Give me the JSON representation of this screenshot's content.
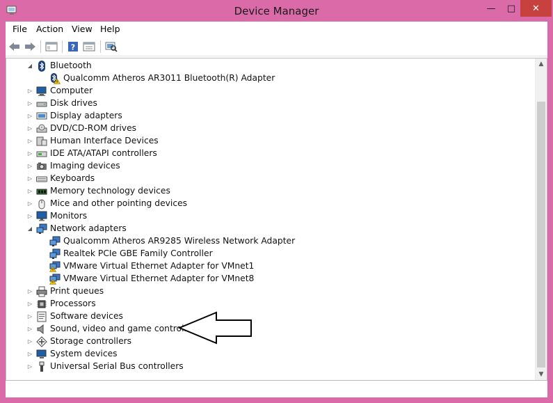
{
  "window": {
    "title": "Device Manager",
    "min_label": "—",
    "max_label": "□",
    "close_label": "✕"
  },
  "menubar": {
    "file": "File",
    "action": "Action",
    "view": "View",
    "help": "Help"
  },
  "toolbar": {
    "icons": [
      "back-arrow-icon",
      "forward-arrow-icon",
      "properties-icon",
      "help-icon",
      "console-tree-icon",
      "scan-hardware-icon"
    ]
  },
  "tree": {
    "items": [
      {
        "label": "Bluetooth",
        "level": 0,
        "expanded": true,
        "icon": "bluetooth-icon"
      },
      {
        "label": "Qualcomm Atheros AR3011 Bluetooth(R) Adapter",
        "level": 1,
        "icon": "bluetooth-warning-icon"
      },
      {
        "label": "Computer",
        "level": 0,
        "expanded": false,
        "icon": "computer-icon"
      },
      {
        "label": "Disk drives",
        "level": 0,
        "expanded": false,
        "icon": "disk-drive-icon"
      },
      {
        "label": "Display adapters",
        "level": 0,
        "expanded": false,
        "icon": "display-adapter-icon"
      },
      {
        "label": "DVD/CD-ROM drives",
        "level": 0,
        "expanded": false,
        "icon": "dvd-drive-icon"
      },
      {
        "label": "Human Interface Devices",
        "level": 0,
        "expanded": false,
        "icon": "hid-icon"
      },
      {
        "label": "IDE ATA/ATAPI controllers",
        "level": 0,
        "expanded": false,
        "icon": "ide-controller-icon"
      },
      {
        "label": "Imaging devices",
        "level": 0,
        "expanded": false,
        "icon": "camera-icon"
      },
      {
        "label": "Keyboards",
        "level": 0,
        "expanded": false,
        "icon": "keyboard-icon"
      },
      {
        "label": "Memory technology devices",
        "level": 0,
        "expanded": false,
        "icon": "memory-icon"
      },
      {
        "label": "Mice and other pointing devices",
        "level": 0,
        "expanded": false,
        "icon": "mouse-icon"
      },
      {
        "label": "Monitors",
        "level": 0,
        "expanded": false,
        "icon": "monitor-icon"
      },
      {
        "label": "Network adapters",
        "level": 0,
        "expanded": true,
        "icon": "network-adapter-icon"
      },
      {
        "label": "Qualcomm Atheros AR9285 Wireless Network Adapter",
        "level": 1,
        "icon": "network-adapter-icon"
      },
      {
        "label": "Realtek PCIe GBE Family Controller",
        "level": 1,
        "icon": "network-adapter-icon"
      },
      {
        "label": "VMware Virtual Ethernet Adapter for VMnet1",
        "level": 1,
        "icon": "network-warning-icon"
      },
      {
        "label": "VMware Virtual Ethernet Adapter for VMnet8",
        "level": 1,
        "icon": "network-warning-icon"
      },
      {
        "label": "Print queues",
        "level": 0,
        "expanded": false,
        "icon": "printer-icon"
      },
      {
        "label": "Processors",
        "level": 0,
        "expanded": false,
        "icon": "processor-icon"
      },
      {
        "label": "Software devices",
        "level": 0,
        "expanded": false,
        "icon": "software-device-icon"
      },
      {
        "label": "Sound, video and game controllers",
        "level": 0,
        "expanded": false,
        "icon": "speaker-icon"
      },
      {
        "label": "Storage controllers",
        "level": 0,
        "expanded": false,
        "icon": "storage-controller-icon"
      },
      {
        "label": "System devices",
        "level": 0,
        "expanded": false,
        "icon": "system-device-icon"
      },
      {
        "label": "Universal Serial Bus controllers",
        "level": 0,
        "expanded": false,
        "icon": "usb-icon"
      }
    ]
  },
  "colors": {
    "frame": "#db6aa9",
    "close": "#c7423f",
    "warning": "#f2c200"
  }
}
